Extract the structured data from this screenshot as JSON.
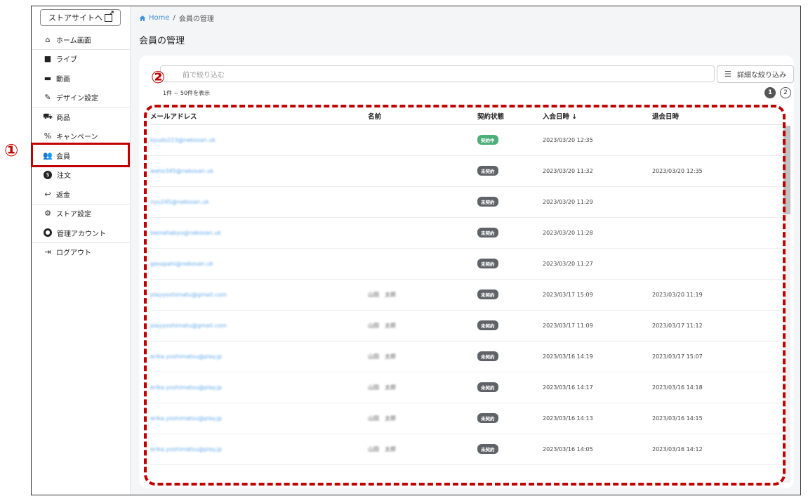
{
  "sidebar": {
    "store_button": "ストアサイトへ",
    "items": [
      {
        "label": "ホーム画面",
        "icon": "home-icon"
      },
      {
        "label": "ライブ",
        "icon": "video-camera-icon"
      },
      {
        "label": "動画",
        "icon": "clapperboard-icon"
      },
      {
        "label": "デザイン設定",
        "icon": "brush-icon"
      },
      {
        "label": "商品",
        "icon": "cart-icon"
      },
      {
        "label": "キャンペーン",
        "icon": "percent-icon"
      },
      {
        "label": "会員",
        "icon": "people-icon"
      },
      {
        "label": "注文",
        "icon": "dollar-icon"
      },
      {
        "label": "返金",
        "icon": "reply-icon"
      },
      {
        "label": "ストア設定",
        "icon": "gear-icon"
      },
      {
        "label": "管理アカウント",
        "icon": "account-icon"
      },
      {
        "label": "ログアウト",
        "icon": "logout-icon"
      }
    ]
  },
  "breadcrumb": {
    "home": "Home",
    "sep": "/",
    "current": "会員の管理"
  },
  "page_title": "会員の管理",
  "search": {
    "placeholder": "前で絞り込む"
  },
  "filter_button": "詳細な絞り込み",
  "result_count": "1件 ~ 50件を表示",
  "pagination": [
    "1",
    "2"
  ],
  "table": {
    "headers": [
      "メールアドレス",
      "名前",
      "契約状態",
      "入会日時 ↓",
      "退会日時"
    ],
    "rows": [
      {
        "email": "kyudo223@nekosan.uk",
        "name": "",
        "status": "契約中",
        "joined": "2023/03/20 12:35",
        "left": ""
      },
      {
        "email": "waho345@nekosan.uk",
        "name": "",
        "status": "未契約",
        "joined": "2023/03/20 11:32",
        "left": "2023/03/20 12:35"
      },
      {
        "email": "nyu245@nekosan.uk",
        "name": "",
        "status": "未契約",
        "joined": "2023/03/20 11:29",
        "left": ""
      },
      {
        "email": "bemahabyo@nekosan.uk",
        "name": "",
        "status": "未契約",
        "joined": "2023/03/20 11:28",
        "left": ""
      },
      {
        "email": "gasopahi@nekosan.uk",
        "name": "",
        "status": "未契約",
        "joined": "2023/03/20 11:27",
        "left": ""
      },
      {
        "email": "playyoshimatu@gmail.com",
        "name": "山田　太郎",
        "status": "未契約",
        "joined": "2023/03/17 15:09",
        "left": "2023/03/20 11:19"
      },
      {
        "email": "playyoshimatu@gmail.com",
        "name": "山田　太郎",
        "status": "未契約",
        "joined": "2023/03/17 11:09",
        "left": "2023/03/17 11:12"
      },
      {
        "email": "erika.yoshimatsu@play.jp",
        "name": "山田　太郎",
        "status": "未契約",
        "joined": "2023/03/16 14:19",
        "left": "2023/03/17 15:07"
      },
      {
        "email": "erika.yoshimatsu@play.jp",
        "name": "山田　太郎",
        "status": "未契約",
        "joined": "2023/03/16 14:17",
        "left": "2023/03/16 14:18"
      },
      {
        "email": "erika.yoshimatsu@play.jp",
        "name": "山田　太郎",
        "status": "未契約",
        "joined": "2023/03/16 14:13",
        "left": "2023/03/16 14:15"
      },
      {
        "email": "erika.yoshimatsu@play.jp",
        "name": "山田　太郎",
        "status": "未契約",
        "joined": "2023/03/16 14:05",
        "left": "2023/03/16 14:12"
      }
    ]
  },
  "colors": {
    "active_badge": "#4caf7a",
    "inactive_badge": "#5f6368",
    "link": "#5fa7e8",
    "annotation": "#c00000"
  },
  "annotations": [
    "①",
    "②"
  ]
}
